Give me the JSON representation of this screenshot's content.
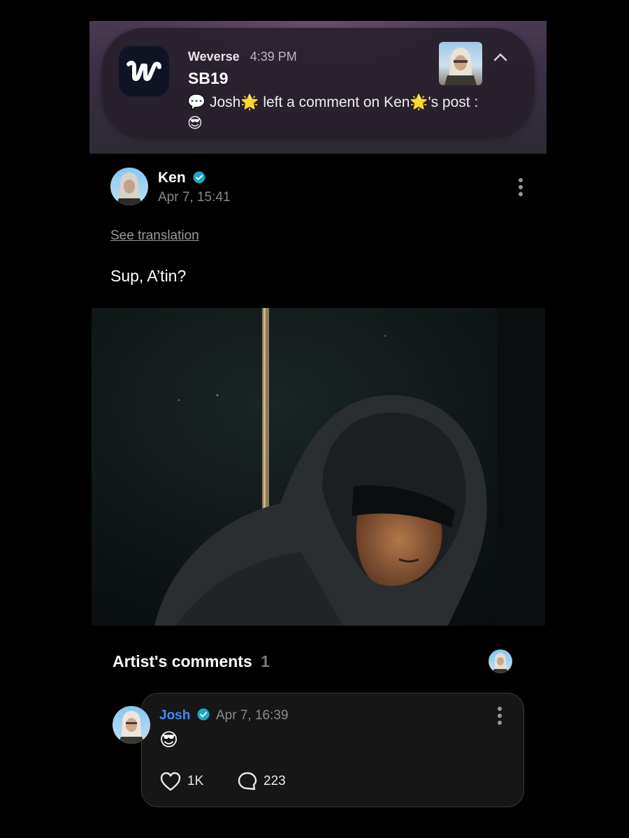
{
  "notification": {
    "app_name": "Weverse",
    "time": "4:39 PM",
    "title": "SB19",
    "body_line1": "💬 Josh🌟 left a comment on Ken🌟's post :",
    "body_line2": "😎",
    "app_icon": "weverse-logo",
    "collapse_icon": "chevron-up-icon"
  },
  "post": {
    "author": "Ken",
    "date": "Apr 7, 15:41",
    "see_translation": "See translation",
    "text": "Sup, A’tin?",
    "more_icon": "more-vertical-icon",
    "verified_icon": "verified-badge-icon"
  },
  "artist_comments": {
    "title": "Artist's comments",
    "count": "1"
  },
  "comment": {
    "author": "Josh",
    "date": "Apr 7, 16:39",
    "text": "😎",
    "likes": "1K",
    "replies": "223",
    "like_icon": "heart-icon",
    "reply_icon": "comment-bubble-icon"
  },
  "colors": {
    "accent_blue": "#3d8bfd",
    "verified": "#1aa8c4",
    "muted": "#8a8a8a"
  }
}
